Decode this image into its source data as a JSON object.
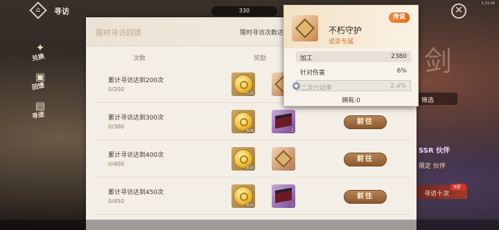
{
  "version": "1.11.14",
  "topbar": {
    "title": "寻访",
    "currency_value": "330",
    "home_glyph": "⌂",
    "close_glyph": "✕"
  },
  "side_nav": [
    {
      "label": "兑换",
      "icon": "exchange-icon",
      "glyph": "✦"
    },
    {
      "label": "回馈",
      "icon": "gift-icon",
      "glyph": "▣"
    },
    {
      "label": "寻迹",
      "icon": "ticket-icon",
      "glyph": "▤"
    }
  ],
  "panel": {
    "title": "限时寻访回馈",
    "progress_label": "限时寻访次数达",
    "col_count": "次数",
    "col_reward": "奖励"
  },
  "rows": [
    {
      "name": "累计寻访达到200次",
      "current": "0",
      "total": "/200",
      "coin_qty": "50K",
      "item_qty": "",
      "item_color": "orange",
      "button": ""
    },
    {
      "name": "累计寻访达到300次",
      "current": "0",
      "total": "/300",
      "coin_qty": "80K",
      "item_qty": "2",
      "item_color": "purple",
      "button": "前往"
    },
    {
      "name": "累计寻访达到400次",
      "current": "0",
      "total": "/400",
      "coin_qty": "80K",
      "item_qty": "1",
      "item_color": "orange",
      "button": "前往"
    },
    {
      "name": "累计寻访达到450次",
      "current": "0",
      "total": "/450",
      "coin_qty": "80K",
      "item_qty": "2",
      "item_color": "purple",
      "button": "前往"
    }
  ],
  "tooltip": {
    "badge": "传说",
    "name": "不朽守护",
    "sub": "诺亚专属",
    "stats": [
      {
        "key": "加工",
        "value": "2380",
        "style": "shade"
      },
      {
        "key": "针对伤害",
        "value": "6%",
        "style": ""
      },
      {
        "key": "二次行动率",
        "value": "2.4%",
        "style": "locked"
      }
    ],
    "owned": "拥有:0"
  },
  "background": {
    "big_char": "剑",
    "ssr_text": "SSR 伙伴",
    "limited_text": "限定 伙伴",
    "ten_draw": "寻访十次",
    "discount": "9折",
    "filter": "筛选"
  }
}
